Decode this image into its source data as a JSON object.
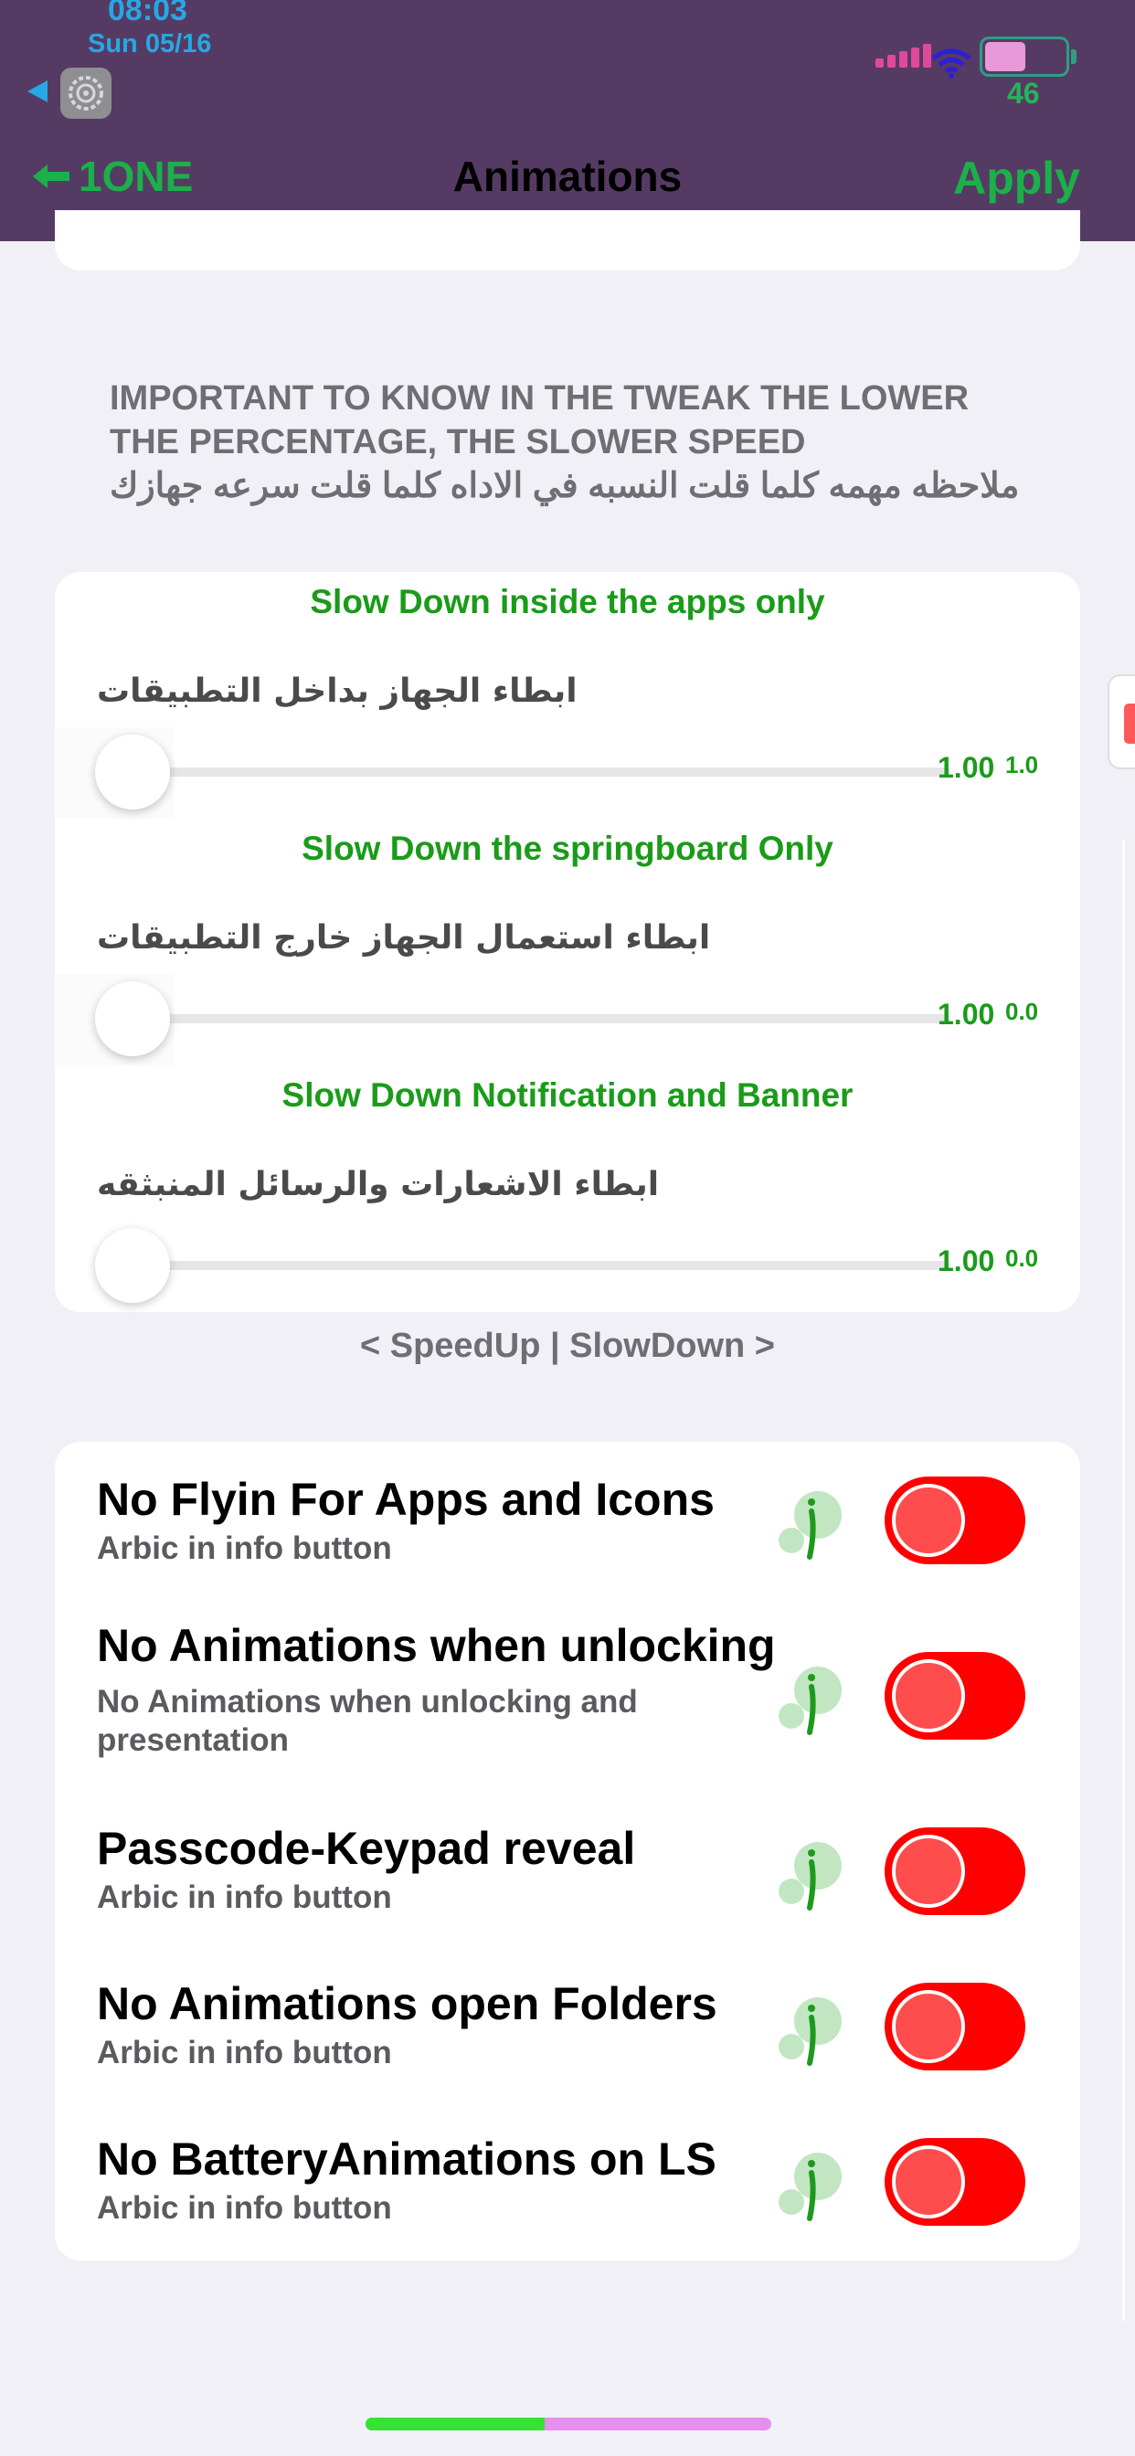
{
  "status_bar": {
    "time": "08:03",
    "date": "Sun 05/16",
    "battery_percent": "46",
    "battery_level": 0.46
  },
  "nav": {
    "back_label": "1ONE",
    "title": "Animations",
    "apply_label": "Apply"
  },
  "note": {
    "english": "IMPORTANT TO KNOW IN THE TWEAK THE LOWER THE PERCENTAGE, THE SLOWER SPEED",
    "arabic": "ملاحظه مهمه كلما قلت النسبه في الاداه كلما قلت سرعه جهازك"
  },
  "sliders": [
    {
      "title": "Slow Down inside the apps only",
      "arabic_label": "ابطاء الجهاز بداخل التطبيقات",
      "value": "1.00",
      "small_value": "1.0"
    },
    {
      "title": "Slow Down the springboard Only",
      "arabic_label": "ابطاء استعمال الجهاز خارج التطبيقات",
      "value": "1.00",
      "small_value": "0.0"
    },
    {
      "title": "Slow Down Notification and Banner",
      "arabic_label": "ابطاء الاشعارات والرسائل المنبثقه",
      "value": "1.00",
      "small_value": "0.0"
    }
  ],
  "slider_footer": "< SpeedUp | SlowDown >",
  "toggles": [
    {
      "title": "No Flyin For Apps and Icons",
      "subtitle": "Arbic in info button",
      "on": true
    },
    {
      "title": "No Animations when unlocking",
      "subtitle": "No Animations when unlocking and presentation",
      "on": true
    },
    {
      "title": "Passcode-Keypad reveal",
      "subtitle": "Arbic in info button",
      "on": true
    },
    {
      "title": "No Animations open Folders",
      "subtitle": "Arbic in info button",
      "on": true
    },
    {
      "title": "No BatteryAnimations on LS",
      "subtitle": "Arbic in info button",
      "on": true
    }
  ],
  "colors": {
    "header_bg": "#553b63",
    "accent_green": "#1a9b1a",
    "switch_on": "#ff0000",
    "time_blue": "#25a8e3"
  },
  "icons": [
    "settings-icon",
    "signal-icon",
    "wifi-icon",
    "battery-icon",
    "back-arrow-icon",
    "info-icon"
  ]
}
